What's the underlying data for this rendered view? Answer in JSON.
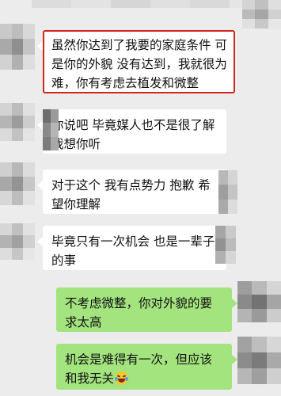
{
  "conversation": {
    "messages": [
      {
        "side": "incoming",
        "highlighted": true,
        "text": "虽然你达到了我要的家庭条件 可是你的外貌 没有达到，我就很为难，你有考虑去植发和微整"
      },
      {
        "side": "incoming",
        "highlighted": false,
        "text": "你说吧 毕竟媒人也不是很了解 我想你听"
      },
      {
        "side": "incoming",
        "highlighted": false,
        "text": "对于这个 我有点势力  抱歉 希望你理解"
      },
      {
        "side": "incoming",
        "highlighted": false,
        "text": "毕竟只有一次机会 也是一辈子的事"
      },
      {
        "side": "outgoing",
        "highlighted": false,
        "text": "不考虑微整，你对外貌的要求太高"
      },
      {
        "side": "outgoing",
        "highlighted": false,
        "text": "机会是难得有一次，但应该和我无关",
        "emoji": "laughing-tears-emoji"
      }
    ]
  },
  "colors": {
    "background": "#ececec",
    "incoming_bubble": "#ffffff",
    "outgoing_bubble": "#a3e47f",
    "highlight_border": "#d0251b"
  }
}
